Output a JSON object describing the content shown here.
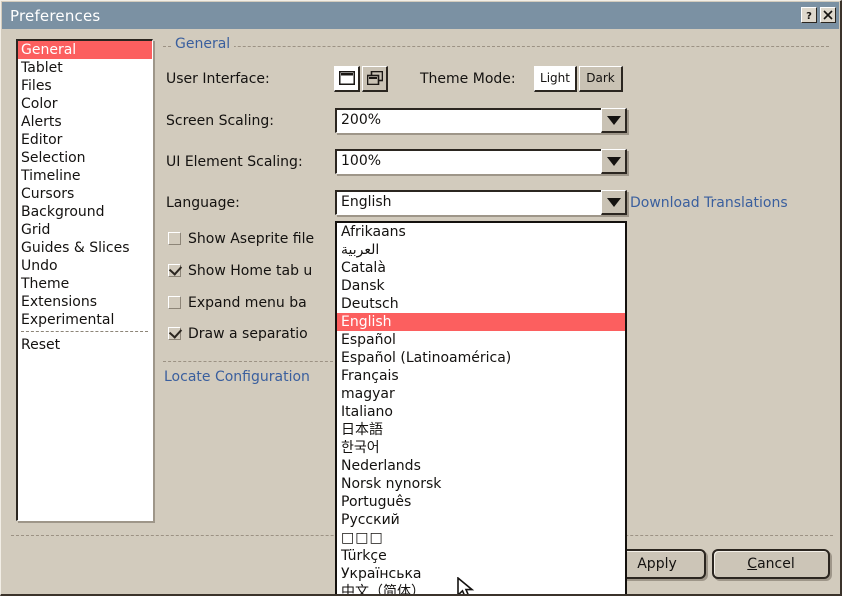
{
  "window": {
    "title": "Preferences",
    "help_button": "?",
    "close_button": "X",
    "bg_color": "#d2cbbd",
    "titlebar_color": "#7b91a3",
    "accent_color": "#fc5f5f",
    "link_color": "#3a5f9e"
  },
  "sidebar": {
    "items": [
      {
        "label": "General",
        "selected": true
      },
      {
        "label": "Tablet",
        "selected": false
      },
      {
        "label": "Files",
        "selected": false
      },
      {
        "label": "Color",
        "selected": false
      },
      {
        "label": "Alerts",
        "selected": false
      },
      {
        "label": "Editor",
        "selected": false
      },
      {
        "label": "Selection",
        "selected": false
      },
      {
        "label": "Timeline",
        "selected": false
      },
      {
        "label": "Cursors",
        "selected": false
      },
      {
        "label": "Background",
        "selected": false
      },
      {
        "label": "Grid",
        "selected": false
      },
      {
        "label": "Guides & Slices",
        "selected": false
      },
      {
        "label": "Undo",
        "selected": false
      },
      {
        "label": "Theme",
        "selected": false
      },
      {
        "label": "Extensions",
        "selected": false
      },
      {
        "label": "Experimental",
        "selected": false
      }
    ],
    "reset_label": "Reset"
  },
  "main": {
    "group_title": "General",
    "user_interface": {
      "label": "User Interface:",
      "options": [
        {
          "icon": "single-window-icon",
          "selected": true
        },
        {
          "icon": "multi-window-icon",
          "selected": false
        }
      ]
    },
    "theme_mode": {
      "label": "Theme Mode:",
      "options": [
        {
          "label": "Light",
          "selected": true
        },
        {
          "label": "Dark",
          "selected": false
        }
      ]
    },
    "screen_scaling": {
      "label": "Screen Scaling:",
      "value": "200%"
    },
    "ui_element_scaling": {
      "label": "UI Element Scaling:",
      "value": "100%"
    },
    "language": {
      "label": "Language:",
      "value": "English",
      "download_link": "Download Translations"
    },
    "checkboxes": [
      {
        "label": "Show Aseprite file",
        "checked": false
      },
      {
        "label": "Show Home tab u",
        "checked": true
      },
      {
        "label": "Expand menu ba",
        "checked": false
      },
      {
        "label": "Draw a separatio",
        "checked": true
      }
    ],
    "locate_config_link": "Locate Configuration"
  },
  "dropdown": {
    "open": true,
    "items": [
      {
        "label": "Afrikaans",
        "selected": false
      },
      {
        "label": "العربية",
        "selected": false
      },
      {
        "label": "Català",
        "selected": false
      },
      {
        "label": "Dansk",
        "selected": false
      },
      {
        "label": "Deutsch",
        "selected": false
      },
      {
        "label": "English",
        "selected": true
      },
      {
        "label": "Español",
        "selected": false
      },
      {
        "label": "Español (Latinoamérica)",
        "selected": false
      },
      {
        "label": "Français",
        "selected": false
      },
      {
        "label": "magyar",
        "selected": false
      },
      {
        "label": "Italiano",
        "selected": false
      },
      {
        "label": "日本語",
        "selected": false
      },
      {
        "label": "한국어",
        "selected": false
      },
      {
        "label": "Nederlands",
        "selected": false
      },
      {
        "label": "Norsk nynorsk",
        "selected": false
      },
      {
        "label": "Português",
        "selected": false
      },
      {
        "label": "Русский",
        "selected": false
      },
      {
        "label": "□□□",
        "selected": false
      },
      {
        "label": "Türkçe",
        "selected": false
      },
      {
        "label": "Українська",
        "selected": false
      },
      {
        "label": "中文（简体）",
        "selected": false
      }
    ]
  },
  "footer": {
    "apply_label": "Apply",
    "cancel_label": "Cancel",
    "cancel_accel": "C"
  }
}
